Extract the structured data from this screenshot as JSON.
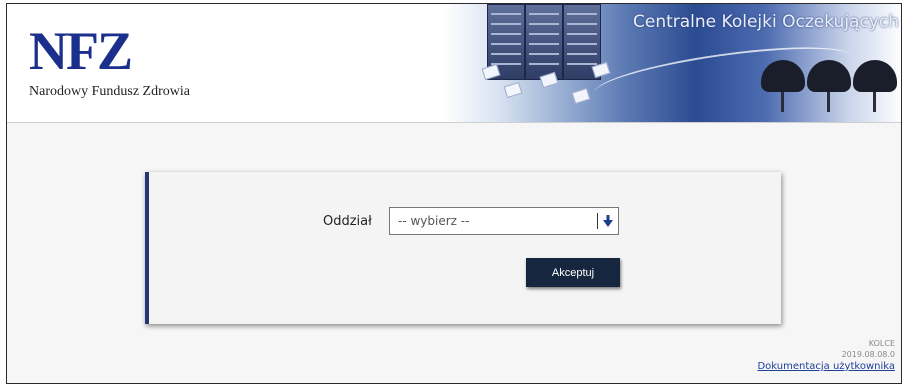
{
  "header": {
    "logo_mark": "NFZ",
    "logo_subtitle": "Narodowy Fundusz Zdrowia",
    "banner_title": "Centralne Kolejki Oczekujących"
  },
  "form": {
    "oddzial_label": "Oddział",
    "oddzial_selected": "-- wybierz --",
    "accept_button": "Akceptuj"
  },
  "footer": {
    "app_name": "KOLCE",
    "version": "2019.08.08.0",
    "docs_link": "Dokumentacja użytkownika"
  },
  "colors": {
    "brand_blue": "#1b2f8c",
    "button_bg": "#17263f",
    "panel_accent": "#2a3470",
    "link": "#1e3f9a"
  },
  "icons": {
    "select_arrow": "arrow-down-icon"
  }
}
